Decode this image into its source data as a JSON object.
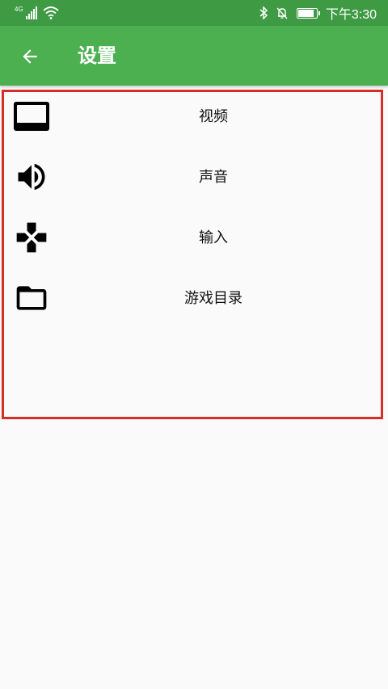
{
  "status_bar": {
    "network_type": "4G",
    "time": "下午3:30",
    "battery_level": 0.8,
    "icons": [
      "signal-icon",
      "wifi-icon",
      "bluetooth-icon",
      "notifications-off-icon",
      "battery-icon"
    ]
  },
  "app_bar": {
    "title": "设置",
    "back_icon": "arrow-back-icon",
    "background": "#4caf50"
  },
  "menu": {
    "items": [
      {
        "label": "视频",
        "icon": "video-display-icon"
      },
      {
        "label": "声音",
        "icon": "volume-icon"
      },
      {
        "label": "输入",
        "icon": "gamepad-icon"
      },
      {
        "label": "游戏目录",
        "icon": "folder-icon"
      }
    ]
  },
  "colors": {
    "status_bar": "#3f9a44",
    "highlight_border": "#d42e26",
    "background": "#fafafa"
  }
}
